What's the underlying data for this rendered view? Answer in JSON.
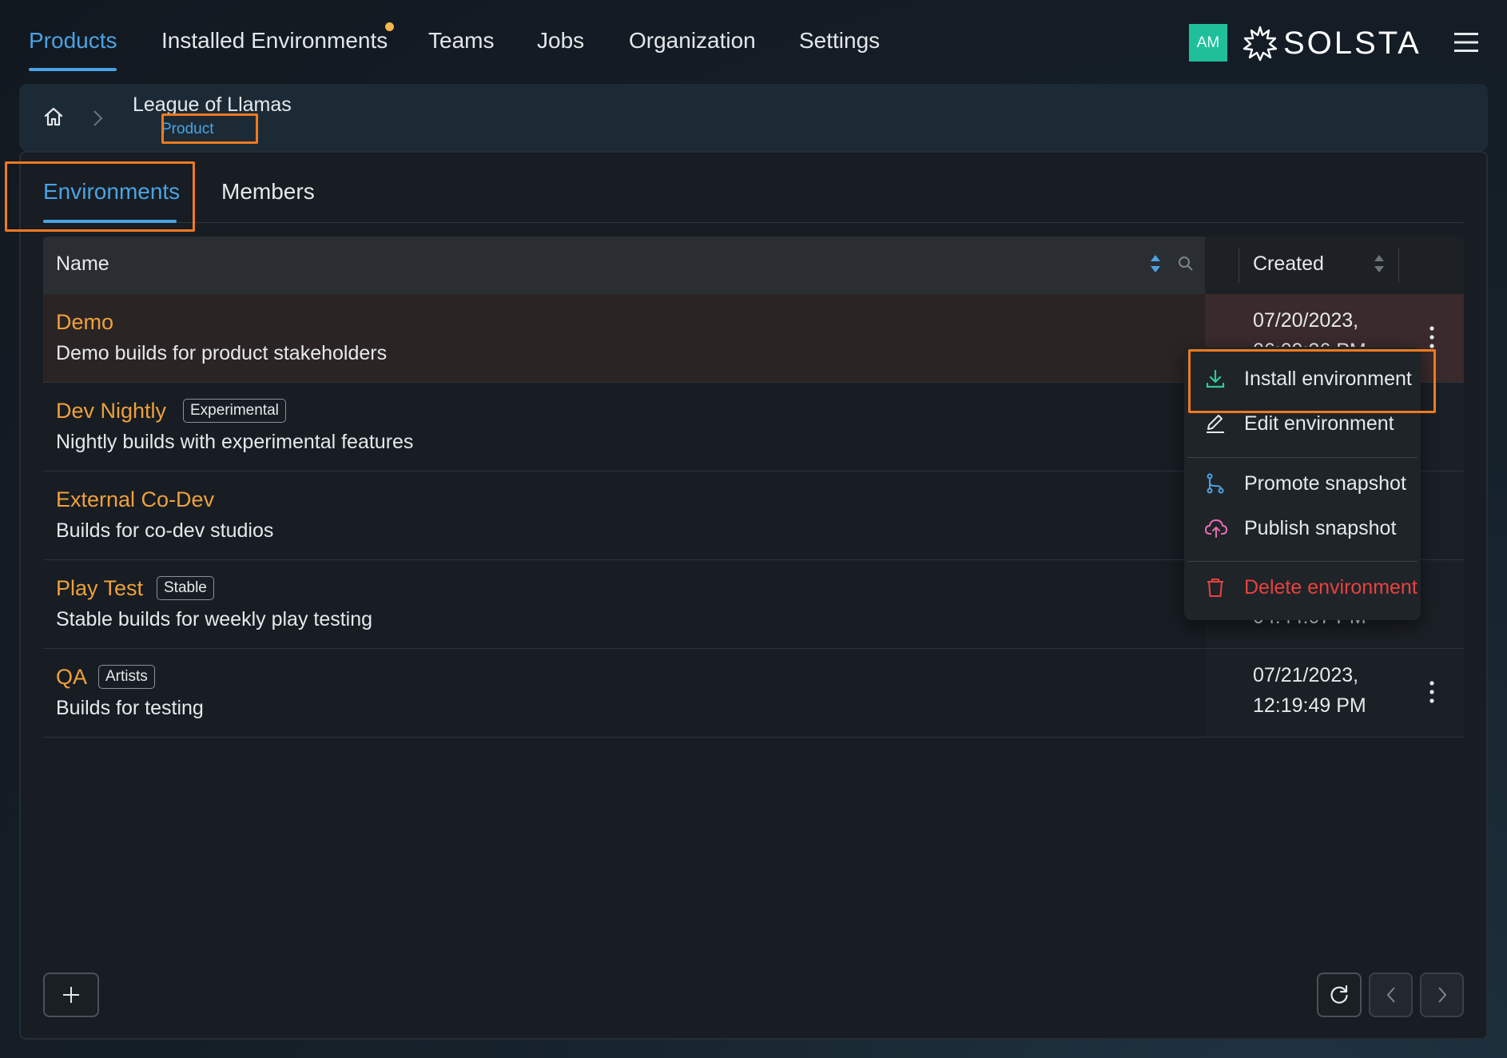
{
  "nav": {
    "items": [
      {
        "label": "Products",
        "active": true
      },
      {
        "label": "Installed Environments",
        "has_dot": true
      },
      {
        "label": "Teams"
      },
      {
        "label": "Jobs"
      },
      {
        "label": "Organization"
      },
      {
        "label": "Settings"
      }
    ],
    "avatar_initials": "AM",
    "logo_text": "SOLSTA",
    "menu_icon": "hamburger-icon"
  },
  "breadcrumb": {
    "home_icon": "home-icon",
    "separator_icon": "chevron-right-icon",
    "title": "League of Llamas",
    "subtitle": "Product"
  },
  "tabs": [
    {
      "label": "Environments",
      "active": true
    },
    {
      "label": "Members"
    }
  ],
  "table": {
    "columns": {
      "name": "Name",
      "created": "Created"
    },
    "rows": [
      {
        "name": "Demo",
        "badge": "",
        "description": "Demo builds for product stakeholders",
        "created_date": "07/20/2023,",
        "created_time": "06:09:36 PM"
      },
      {
        "name": "Dev Nightly",
        "badge": "Experimental",
        "description": "Nightly builds with experimental features",
        "created_date": "",
        "created_time": ""
      },
      {
        "name": "External Co-Dev",
        "badge": "",
        "description": "Builds for co-dev studios",
        "created_date": "",
        "created_time": ""
      },
      {
        "name": "Play Test",
        "badge": "Stable",
        "description": "Stable builds for weekly play testing",
        "created_date": "",
        "created_time": "04:44:07 PM"
      },
      {
        "name": "QA",
        "badge": "Artists",
        "description": "Builds for testing",
        "created_date": "07/21/2023,",
        "created_time": "12:19:49 PM"
      }
    ]
  },
  "context_menu": {
    "items": [
      {
        "label": "Install environment",
        "icon": "download-icon"
      },
      {
        "label": "Edit environment",
        "icon": "pencil-icon"
      },
      {
        "label": "Promote snapshot",
        "icon": "branch-icon"
      },
      {
        "label": "Publish snapshot",
        "icon": "cloud-upload-icon"
      },
      {
        "label": "Delete environment",
        "icon": "trash-icon",
        "danger": true
      }
    ]
  },
  "footer": {
    "add_icon": "plus-icon",
    "refresh_icon": "refresh-icon",
    "prev_icon": "chevron-left-icon",
    "next_icon": "chevron-right-icon"
  },
  "colors": {
    "accent": "#4ba3e3",
    "env_name": "#f0a13a",
    "highlight": "#f07a1f",
    "danger": "#e8423f",
    "avatar": "#1fbf9a"
  }
}
